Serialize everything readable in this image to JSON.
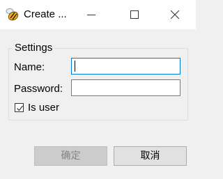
{
  "window": {
    "title": "Create ...",
    "icon": "bee-app-icon",
    "controls": {
      "minimize": "minimize-icon",
      "maximize": "maximize-icon",
      "close": "close-icon"
    }
  },
  "settings": {
    "legend": "Settings",
    "name_label": "Name:",
    "name_value": "",
    "password_label": "Password:",
    "password_value": "",
    "is_user_label": "Is user",
    "is_user_checked": true
  },
  "buttons": {
    "ok_label": "确定",
    "ok_enabled": false,
    "cancel_label": "取消"
  },
  "colors": {
    "title_bar": "#ffffff",
    "dialog_bg": "#f0f0f0",
    "focus_border": "#0078d7",
    "disabled_button": "#cccccc",
    "button_bg": "#e1e1e1"
  }
}
